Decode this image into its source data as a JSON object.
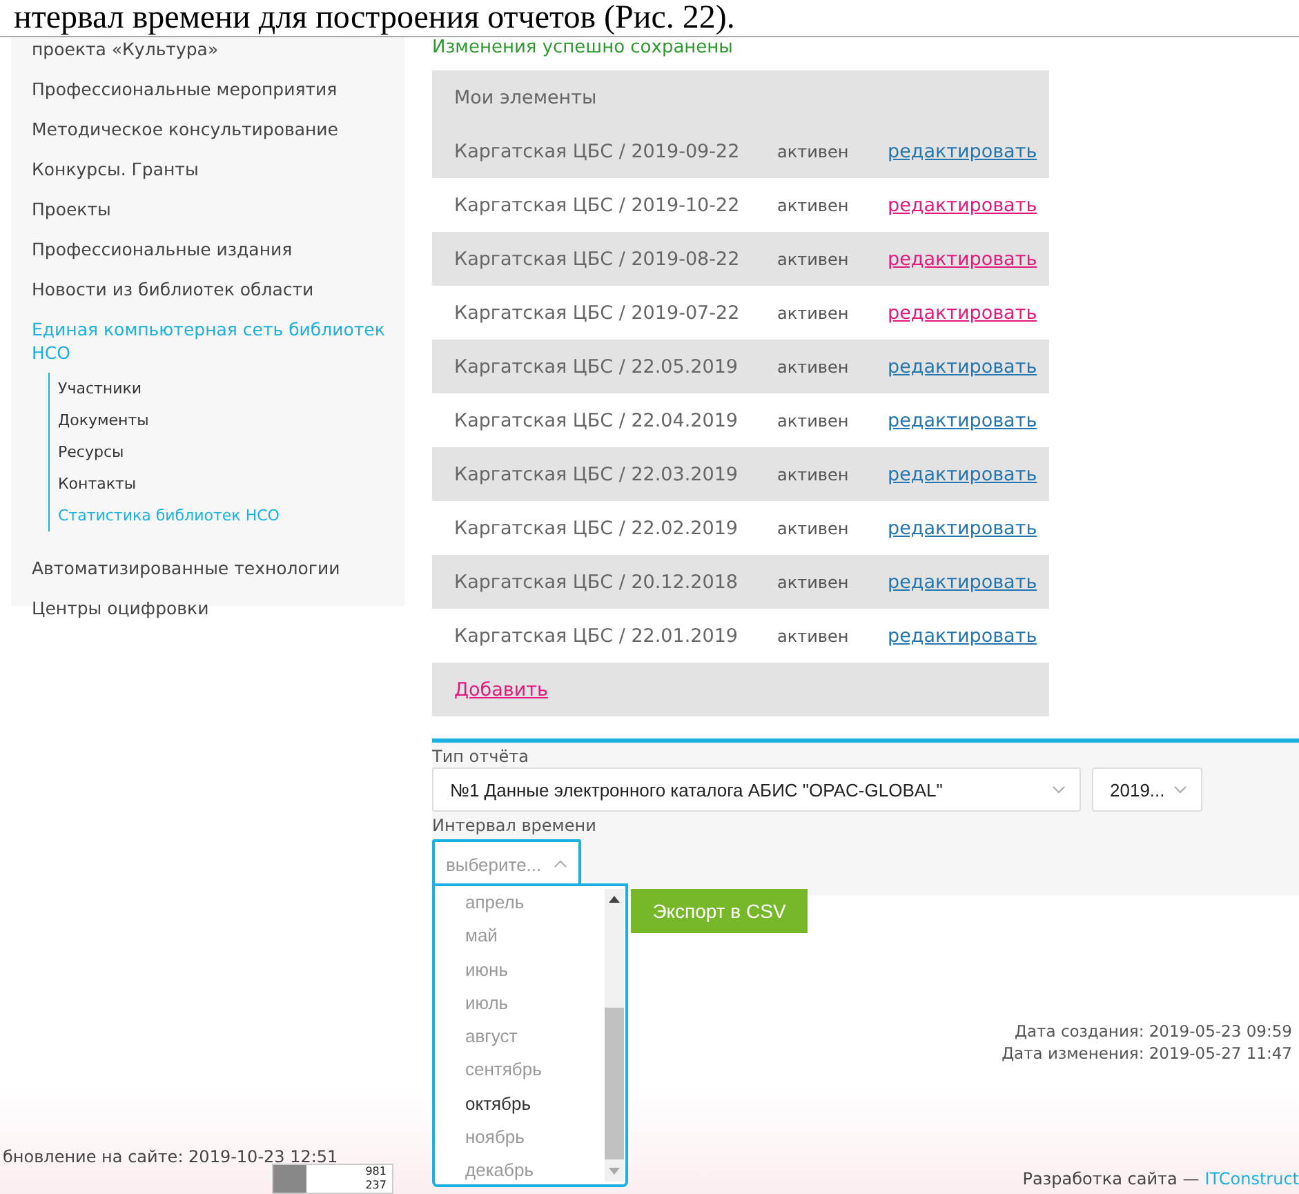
{
  "document_caption": "нтервал времени для построения отчетов (Рис. 22).",
  "sidebar": {
    "items": [
      {
        "label": "проекта «Культура»",
        "active": false
      },
      {
        "label": "Профессиональные мероприятия",
        "active": false
      },
      {
        "label": "Методическое консультирование",
        "active": false
      },
      {
        "label": "Конкурсы. Гранты",
        "active": false
      },
      {
        "label": "Проекты",
        "active": false
      },
      {
        "label": "Профессиональные издания",
        "active": false
      },
      {
        "label": "Новости из библиотек области",
        "active": false
      },
      {
        "label": "Единая компьютерная сеть библиотек НСО",
        "active": true,
        "children": [
          {
            "label": "Участники",
            "active": false
          },
          {
            "label": "Документы",
            "active": false
          },
          {
            "label": "Ресурсы",
            "active": false
          },
          {
            "label": "Контакты",
            "active": false
          },
          {
            "label": "Статистика библиотек НСО",
            "active": true
          }
        ]
      },
      {
        "label": "Автоматизированные технологии",
        "active": false
      },
      {
        "label": "Центры оцифровки",
        "active": false
      }
    ]
  },
  "message": "Изменения успешно сохранены",
  "elements": {
    "title": "Мои элементы",
    "rows": [
      {
        "name": "Каргатская ЦБС / 2019-09-22",
        "status": "активен",
        "action": "редактировать",
        "visited": false
      },
      {
        "name": "Каргатская ЦБС / 2019-10-22",
        "status": "активен",
        "action": "редактировать",
        "visited": true
      },
      {
        "name": "Каргатская ЦБС / 2019-08-22",
        "status": "активен",
        "action": "редактировать",
        "visited": true
      },
      {
        "name": "Каргатская ЦБС / 2019-07-22",
        "status": "активен",
        "action": "редактировать",
        "visited": true
      },
      {
        "name": "Каргатская ЦБС / 22.05.2019",
        "status": "активен",
        "action": "редактировать",
        "visited": false
      },
      {
        "name": "Каргатская ЦБС / 22.04.2019",
        "status": "активен",
        "action": "редактировать",
        "visited": false
      },
      {
        "name": "Каргатская ЦБС / 22.03.2019",
        "status": "активен",
        "action": "редактировать",
        "visited": false
      },
      {
        "name": "Каргатская ЦБС / 22.02.2019",
        "status": "активен",
        "action": "редактировать",
        "visited": false
      },
      {
        "name": "Каргатская ЦБС / 20.12.2018",
        "status": "активен",
        "action": "редактировать",
        "visited": false
      },
      {
        "name": "Каргатская ЦБС / 22.01.2019",
        "status": "активен",
        "action": "редактировать",
        "visited": false
      }
    ],
    "add_link": "Добавить"
  },
  "report": {
    "type_label": "Тип отчёта",
    "type_select": {
      "value": "№1 Данные электронного каталога АБИС \"OPAC-GLOBAL\""
    },
    "year_select": {
      "value": "2019..."
    },
    "interval_label": "Интервал времени",
    "interval_select": {
      "placeholder": "выберите...",
      "expanded": true,
      "options": [
        {
          "label": "апрель",
          "selected": false
        },
        {
          "label": "май",
          "selected": false
        },
        {
          "label": "июнь",
          "selected": false
        },
        {
          "label": "июль",
          "selected": false
        },
        {
          "label": "август",
          "selected": false
        },
        {
          "label": "сентябрь",
          "selected": false
        },
        {
          "label": "октябрь",
          "selected": true
        },
        {
          "label": "ноябрь",
          "selected": false
        },
        {
          "label": "декабрь",
          "selected": false
        }
      ]
    },
    "export_button": "Экспорт в CSV"
  },
  "dates": [
    "Дата создания: 2019-05-23 09:59",
    "Дата изменения: 2019-05-27 11:47"
  ],
  "footer": {
    "update_text": "бновление на сайте: 2019-10-23 12:51",
    "counter": [
      "981",
      "237"
    ],
    "credit": "Разработка сайта —",
    "credit_link": "ITConstruct"
  }
}
